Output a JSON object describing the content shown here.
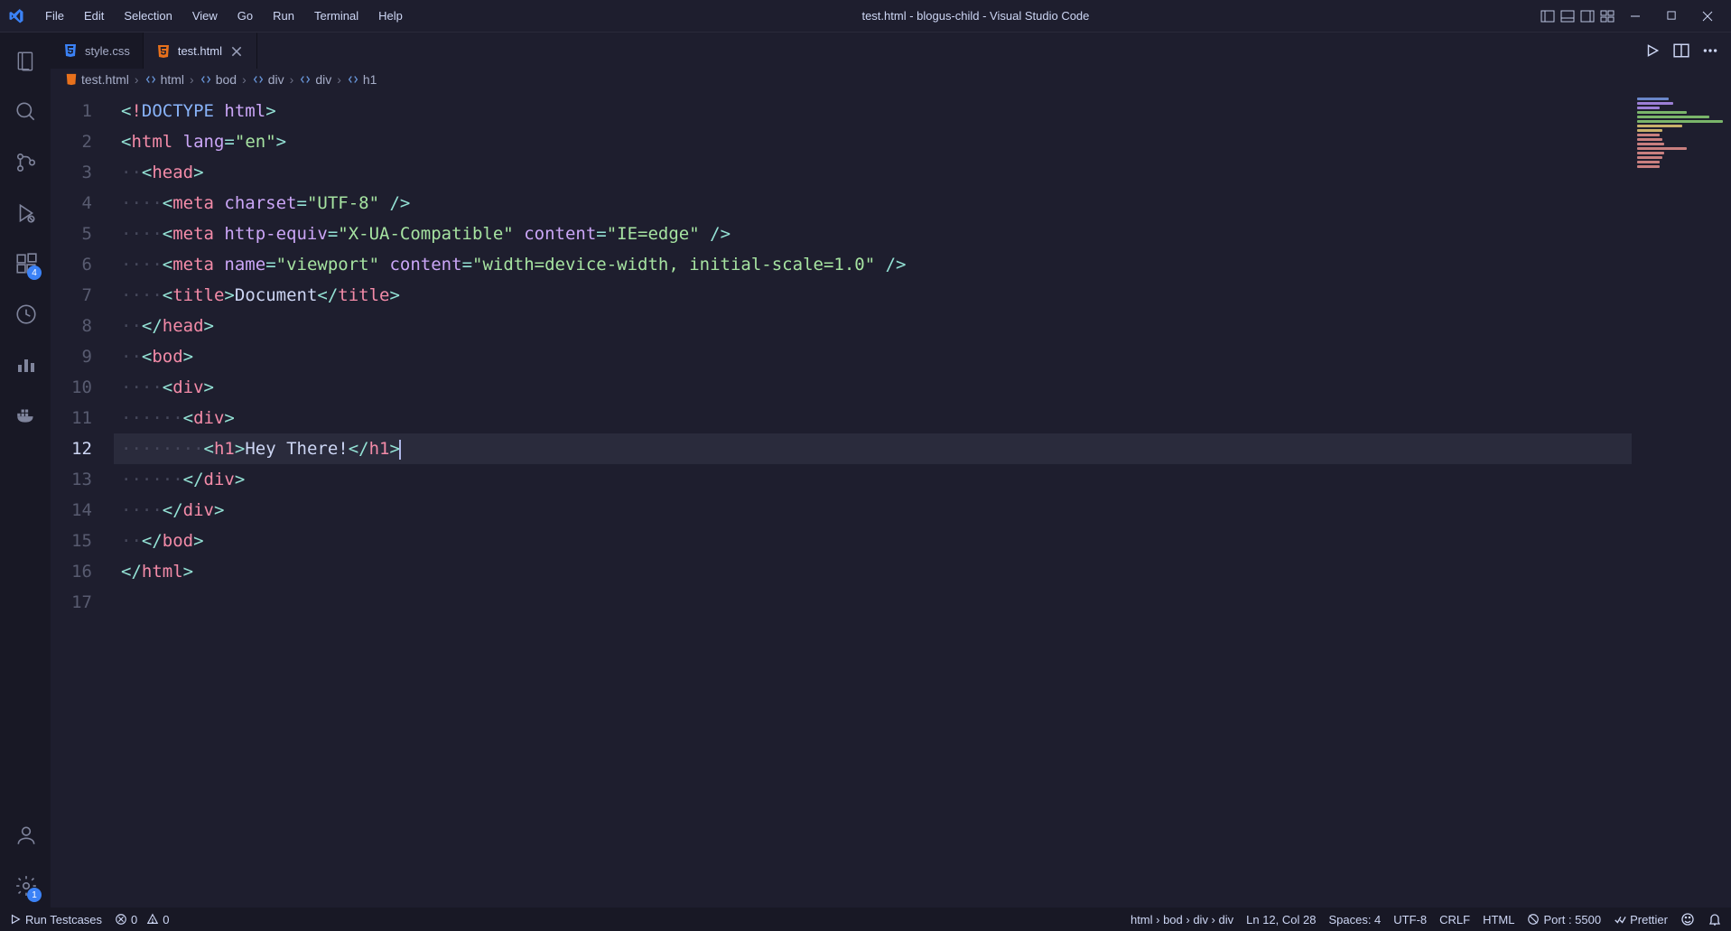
{
  "window": {
    "title": "test.html - blogus-child - Visual Studio Code"
  },
  "menu": [
    "File",
    "Edit",
    "Selection",
    "View",
    "Go",
    "Run",
    "Terminal",
    "Help"
  ],
  "activity": {
    "extensions_badge": "4",
    "settings_badge": "1"
  },
  "tabs": [
    {
      "label": "style.css",
      "icon": "css-icon",
      "active": false
    },
    {
      "label": "test.html",
      "icon": "html-icon",
      "active": true
    }
  ],
  "breadcrumb": [
    {
      "label": "test.html",
      "icon": "html-icon"
    },
    {
      "label": "html",
      "icon": "brackets-icon"
    },
    {
      "label": "bod",
      "icon": "brackets-icon"
    },
    {
      "label": "div",
      "icon": "brackets-icon"
    },
    {
      "label": "div",
      "icon": "brackets-icon"
    },
    {
      "label": "h1",
      "icon": "brackets-icon"
    }
  ],
  "code": {
    "active_line": 12,
    "lines": [
      {
        "num": 1,
        "tokens": [
          [
            "punc",
            "<"
          ],
          [
            "bang",
            "!"
          ],
          [
            "doctype",
            "DOCTYPE "
          ],
          [
            "attr",
            "html"
          ],
          [
            "punc",
            ">"
          ]
        ]
      },
      {
        "num": 2,
        "tokens": [
          [
            "punc",
            "<"
          ],
          [
            "tag",
            "html "
          ],
          [
            "attr",
            "lang"
          ],
          [
            "eq",
            "="
          ],
          [
            "str",
            "\"en\""
          ],
          [
            "punc",
            ">"
          ]
        ]
      },
      {
        "num": 3,
        "tokens": [
          [
            "ws",
            "··"
          ],
          [
            "punc",
            "<"
          ],
          [
            "tag",
            "head"
          ],
          [
            "punc",
            ">"
          ]
        ]
      },
      {
        "num": 4,
        "tokens": [
          [
            "ws",
            "····"
          ],
          [
            "punc",
            "<"
          ],
          [
            "tag",
            "meta "
          ],
          [
            "attr",
            "charset"
          ],
          [
            "eq",
            "="
          ],
          [
            "str",
            "\"UTF-8\""
          ],
          [
            "text",
            " "
          ],
          [
            "punc",
            "/>"
          ]
        ]
      },
      {
        "num": 5,
        "tokens": [
          [
            "ws",
            "····"
          ],
          [
            "punc",
            "<"
          ],
          [
            "tag",
            "meta "
          ],
          [
            "attr",
            "http-equiv"
          ],
          [
            "eq",
            "="
          ],
          [
            "str",
            "\"X-UA-Compatible\""
          ],
          [
            "text",
            " "
          ],
          [
            "attr",
            "content"
          ],
          [
            "eq",
            "="
          ],
          [
            "str",
            "\"IE=edge\""
          ],
          [
            "text",
            " "
          ],
          [
            "punc",
            "/>"
          ]
        ]
      },
      {
        "num": 6,
        "tokens": [
          [
            "ws",
            "····"
          ],
          [
            "punc",
            "<"
          ],
          [
            "tag",
            "meta "
          ],
          [
            "attr",
            "name"
          ],
          [
            "eq",
            "="
          ],
          [
            "str",
            "\"viewport\""
          ],
          [
            "text",
            " "
          ],
          [
            "attr",
            "content"
          ],
          [
            "eq",
            "="
          ],
          [
            "str",
            "\"width=device-width, initial-scale=1.0\""
          ],
          [
            "text",
            " "
          ],
          [
            "punc",
            "/>"
          ]
        ]
      },
      {
        "num": 7,
        "tokens": [
          [
            "ws",
            "····"
          ],
          [
            "punc",
            "<"
          ],
          [
            "tag",
            "title"
          ],
          [
            "punc",
            ">"
          ],
          [
            "text",
            "Document"
          ],
          [
            "punc",
            "</"
          ],
          [
            "tag",
            "title"
          ],
          [
            "punc",
            ">"
          ]
        ]
      },
      {
        "num": 8,
        "tokens": [
          [
            "ws",
            "··"
          ],
          [
            "punc",
            "</"
          ],
          [
            "tag",
            "head"
          ],
          [
            "punc",
            ">"
          ]
        ]
      },
      {
        "num": 9,
        "tokens": [
          [
            "ws",
            "··"
          ],
          [
            "punc",
            "<"
          ],
          [
            "tag",
            "bod"
          ],
          [
            "punc",
            ">"
          ]
        ]
      },
      {
        "num": 10,
        "tokens": [
          [
            "ws",
            "····"
          ],
          [
            "punc",
            "<"
          ],
          [
            "tag",
            "div"
          ],
          [
            "punc",
            ">"
          ]
        ]
      },
      {
        "num": 11,
        "tokens": [
          [
            "ws",
            "······"
          ],
          [
            "punc",
            "<"
          ],
          [
            "tag",
            "div"
          ],
          [
            "punc",
            ">"
          ]
        ]
      },
      {
        "num": 12,
        "tokens": [
          [
            "ws",
            "········"
          ],
          [
            "punc",
            "<"
          ],
          [
            "tag",
            "h1"
          ],
          [
            "punc",
            ">"
          ],
          [
            "text",
            "Hey There!"
          ],
          [
            "punc",
            "</"
          ],
          [
            "tag",
            "h1"
          ],
          [
            "punc",
            ">"
          ]
        ]
      },
      {
        "num": 13,
        "tokens": [
          [
            "ws",
            "······"
          ],
          [
            "punc",
            "</"
          ],
          [
            "tag",
            "div"
          ],
          [
            "punc",
            ">"
          ]
        ]
      },
      {
        "num": 14,
        "tokens": [
          [
            "ws",
            "····"
          ],
          [
            "punc",
            "</"
          ],
          [
            "tag",
            "div"
          ],
          [
            "punc",
            ">"
          ]
        ]
      },
      {
        "num": 15,
        "tokens": [
          [
            "ws",
            "··"
          ],
          [
            "punc",
            "</"
          ],
          [
            "tag",
            "bod"
          ],
          [
            "punc",
            ">"
          ]
        ]
      },
      {
        "num": 16,
        "tokens": [
          [
            "punc",
            "</"
          ],
          [
            "tag",
            "html"
          ],
          [
            "punc",
            ">"
          ]
        ]
      },
      {
        "num": 17,
        "tokens": []
      }
    ]
  },
  "status": {
    "left": {
      "run_testcases": "Run Testcases",
      "errors": "0",
      "warnings": "0"
    },
    "right": {
      "path": "html › bod › div › div",
      "position": "Ln 12, Col 28",
      "spaces": "Spaces: 4",
      "encoding": "UTF-8",
      "eol": "CRLF",
      "language": "HTML",
      "port": "Port : 5500",
      "formatter": "Prettier"
    }
  }
}
